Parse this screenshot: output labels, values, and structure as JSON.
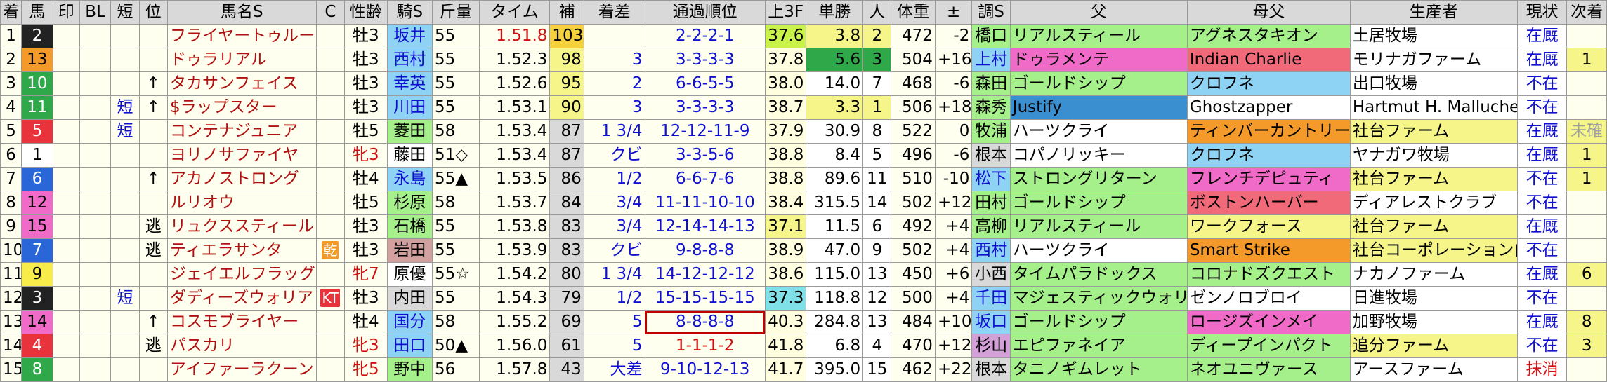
{
  "headers": [
    "着",
    "馬",
    "印",
    "BL",
    "短",
    "位",
    "馬名S",
    "C",
    "性齢",
    "騎S",
    "斤量",
    "タイム",
    "補",
    "着差",
    "通過順位",
    "上3F",
    "単勝",
    "人",
    "体重",
    "±",
    "調S",
    "父",
    "母父",
    "生産者",
    "現状",
    "次着"
  ],
  "colors": {
    "frame": [
      "#ffffff",
      "#ffffff",
      "#222222",
      "#e8323c",
      "#2a66d8",
      "#f8ec4a",
      "#2fa84a",
      "#f39a2a",
      "#f06ac8"
    ],
    "frame_text": [
      "#000000",
      "#000000",
      "#ffffff",
      "#ffffff",
      "#ffffff",
      "#000000",
      "#ffffff",
      "#000000",
      "#000000"
    ],
    "row_bg": "#fffff0",
    "gray_col": "#d9d9d9"
  },
  "rows": [
    {
      "rank": "1",
      "frame": 2,
      "num": "2",
      "mark": "",
      "bl": "",
      "short": "",
      "pos": "",
      "name": "フライヤートゥルー",
      "c": "",
      "c_bg": "",
      "sex": "牡3",
      "sex_red": false,
      "jockey": "坂井",
      "jockey_bg": "#8fd3f4",
      "jockey_blue": true,
      "weight": "55",
      "weight_mark": "",
      "time": "1.51.8",
      "time_red": true,
      "hosei": "103",
      "hosei_bg": "#f5d23d",
      "chakusa": "",
      "pass": [
        "2",
        "2",
        "2",
        "1"
      ],
      "pass_box": false,
      "pass_red": false,
      "f3": "37.6",
      "f3_bg": "#c9f24a",
      "odds": "3.8",
      "odds_bg": "#f5f58a",
      "ninki": "2",
      "ninki_bg": "#f5f58a",
      "bw": "472",
      "diff": "-2",
      "trainer": "橋口",
      "trainer_bg": "#a5f08a",
      "trainer_blue": false,
      "sire": "リアルスティール",
      "sire_bg": "#a5f08a",
      "ds": "アグネスタキオン",
      "ds_bg": "#a5f08a",
      "breeder": "土居牧場",
      "breeder_bg": "#ffffff",
      "status": "在厩",
      "status_color": "blue",
      "next": ""
    },
    {
      "rank": "2",
      "frame": 7,
      "num": "13",
      "mark": "",
      "bl": "",
      "short": "",
      "pos": "",
      "name": "ドゥラリアル",
      "c": "",
      "c_bg": "",
      "sex": "牡3",
      "sex_red": false,
      "jockey": "西村",
      "jockey_bg": "#8fd3f4",
      "jockey_blue": true,
      "weight": "55",
      "weight_mark": "",
      "time": "1.52.3",
      "time_red": false,
      "hosei": "98",
      "hosei_bg": "#f5f58a",
      "chakusa": "3",
      "pass": [
        "3",
        "3",
        "3",
        "3"
      ],
      "pass_box": false,
      "pass_red": false,
      "f3": "37.8",
      "f3_bg": "#ffffe0",
      "odds": "5.6",
      "odds_bg": "#2fa84a",
      "ninki": "3",
      "ninki_bg": "#2fa84a",
      "bw": "504",
      "diff": "+16",
      "trainer": "上村",
      "trainer_bg": "#8fd3f4",
      "trainer_blue": true,
      "sire": "ドゥラメンテ",
      "sire_bg": "#f06ac8",
      "ds": "Indian Charlie",
      "ds_bg": "#f06a7a",
      "breeder": "モリナガファーム",
      "breeder_bg": "#ffffff",
      "status": "在厩",
      "status_color": "blue",
      "next": "1"
    },
    {
      "rank": "3",
      "frame": 6,
      "num": "10",
      "mark": "",
      "bl": "",
      "short": "",
      "pos": "↑",
      "name": "タカサンフェイス",
      "c": "",
      "c_bg": "",
      "sex": "牡3",
      "sex_red": false,
      "jockey": "幸英",
      "jockey_bg": "#8fd3f4",
      "jockey_blue": true,
      "weight": "55",
      "weight_mark": "",
      "time": "1.52.6",
      "time_red": false,
      "hosei": "95",
      "hosei_bg": "#f5f58a",
      "chakusa": "2",
      "pass": [
        "6",
        "6",
        "5",
        "5"
      ],
      "pass_box": false,
      "pass_red": false,
      "f3": "38.0",
      "f3_bg": "#ffffe0",
      "odds": "14.0",
      "odds_bg": "#ffffff",
      "ninki": "7",
      "ninki_bg": "#ffffff",
      "bw": "468",
      "diff": "-6",
      "trainer": "森田",
      "trainer_bg": "#a5f08a",
      "trainer_blue": false,
      "sire": "ゴールドシップ",
      "sire_bg": "#a5f08a",
      "ds": "クロフネ",
      "ds_bg": "#8fd3f4",
      "breeder": "出口牧場",
      "breeder_bg": "#ffffff",
      "status": "不在",
      "status_color": "blue",
      "next": ""
    },
    {
      "rank": "4",
      "frame": 6,
      "num": "11",
      "mark": "",
      "bl": "",
      "short": "短",
      "pos": "↑",
      "name": "$ラップスター",
      "c": "",
      "c_bg": "",
      "sex": "牡3",
      "sex_red": false,
      "jockey": "川田",
      "jockey_bg": "#8fd3f4",
      "jockey_blue": true,
      "weight": "55",
      "weight_mark": "",
      "time": "1.53.1",
      "time_red": false,
      "hosei": "90",
      "hosei_bg": "#f5f58a",
      "chakusa": "3",
      "pass": [
        "3",
        "3",
        "3",
        "3"
      ],
      "pass_box": false,
      "pass_red": false,
      "f3": "38.7",
      "f3_bg": "#ffffe0",
      "odds": "3.3",
      "odds_bg": "#f5f58a",
      "ninki": "1",
      "ninki_bg": "#f5f58a",
      "bw": "506",
      "diff": "+18",
      "trainer": "森秀",
      "trainer_bg": "#a5f08a",
      "trainer_blue": false,
      "sire": "Justify",
      "sire_bg": "#3a8fd0",
      "ds": "Ghostzapper",
      "ds_bg": "#ffffff",
      "breeder": "Hartmut H. Malluche",
      "breeder_bg": "#ffffff",
      "status": "不在",
      "status_color": "blue",
      "next": ""
    },
    {
      "rank": "5",
      "frame": 3,
      "num": "5",
      "mark": "",
      "bl": "",
      "short": "短",
      "pos": "",
      "name": "コンテナジュニア",
      "c": "",
      "c_bg": "",
      "sex": "牡5",
      "sex_red": false,
      "jockey": "菱田",
      "jockey_bg": "#a5f08a",
      "jockey_blue": false,
      "weight": "58",
      "weight_mark": "",
      "time": "1.53.4",
      "time_red": false,
      "hosei": "87",
      "hosei_bg": "",
      "chakusa": "1 3/4",
      "pass": [
        "12",
        "12",
        "11",
        "9"
      ],
      "pass_box": false,
      "pass_red": false,
      "f3": "37.9",
      "f3_bg": "#ffffe0",
      "odds": "30.9",
      "odds_bg": "#ffffff",
      "ninki": "8",
      "ninki_bg": "#ffffff",
      "bw": "522",
      "diff": "0",
      "trainer": "牧浦",
      "trainer_bg": "#a5f08a",
      "trainer_blue": false,
      "sire": "ハーツクライ",
      "sire_bg": "#ffffff",
      "ds": "ティンバーカントリー",
      "ds_bg": "#f39a2a",
      "breeder": "社台ファーム",
      "breeder_bg": "#f5f58a",
      "status": "在厩",
      "status_color": "blue",
      "next": "未確",
      "next_gray": true
    },
    {
      "rank": "6",
      "frame": 1,
      "num": "1",
      "mark": "",
      "bl": "",
      "short": "",
      "pos": "",
      "name": "ヨリノサファイヤ",
      "c": "",
      "c_bg": "",
      "sex": "牝3",
      "sex_red": true,
      "jockey": "藤田",
      "jockey_bg": "#ffffff",
      "jockey_blue": false,
      "weight": "51",
      "weight_mark": "◇",
      "time": "1.53.4",
      "time_red": false,
      "hosei": "87",
      "hosei_bg": "",
      "chakusa": "クビ",
      "pass": [
        "3",
        "3",
        "5",
        "6"
      ],
      "pass_box": false,
      "pass_red": false,
      "f3": "38.8",
      "f3_bg": "#ffffe0",
      "odds": "8.4",
      "odds_bg": "#ffffff",
      "ninki": "5",
      "ninki_bg": "#ffffff",
      "bw": "496",
      "diff": "-6",
      "trainer": "根本",
      "trainer_bg": "#d9d9d9",
      "trainer_blue": false,
      "sire": "コパノリッキー",
      "sire_bg": "#ffffff",
      "ds": "クロフネ",
      "ds_bg": "#8fd3f4",
      "breeder": "ヤナガワ牧場",
      "breeder_bg": "#ffffff",
      "status": "在厩",
      "status_color": "blue",
      "next": "1"
    },
    {
      "rank": "7",
      "frame": 4,
      "num": "6",
      "mark": "",
      "bl": "",
      "short": "",
      "pos": "↑",
      "name": "アカノストロング",
      "c": "",
      "c_bg": "",
      "sex": "牡4",
      "sex_red": false,
      "jockey": "永島",
      "jockey_bg": "#8fd3f4",
      "jockey_blue": true,
      "weight": "55",
      "weight_mark": "▲",
      "time": "1.53.5",
      "time_red": false,
      "hosei": "86",
      "hosei_bg": "",
      "chakusa": "1/2",
      "pass": [
        "6",
        "6",
        "7",
        "6"
      ],
      "pass_box": false,
      "pass_red": false,
      "f3": "38.8",
      "f3_bg": "#ffffe0",
      "odds": "89.6",
      "odds_bg": "#ffffff",
      "ninki": "11",
      "ninki_bg": "#ffffff",
      "bw": "510",
      "diff": "-10",
      "trainer": "松下",
      "trainer_bg": "#8fd3f4",
      "trainer_blue": true,
      "sire": "ストロングリターン",
      "sire_bg": "#a5f08a",
      "ds": "フレンチデピュティ",
      "ds_bg": "#f06ac8",
      "breeder": "社台ファーム",
      "breeder_bg": "#f5f58a",
      "status": "不在",
      "status_color": "blue",
      "next": "1"
    },
    {
      "rank": "8",
      "frame": 8,
      "num": "12",
      "mark": "",
      "bl": "",
      "short": "",
      "pos": "",
      "name": "ルリオウ",
      "c": "",
      "c_bg": "",
      "sex": "牡5",
      "sex_red": false,
      "jockey": "杉原",
      "jockey_bg": "#a5f08a",
      "jockey_blue": false,
      "weight": "58",
      "weight_mark": "",
      "time": "1.53.7",
      "time_red": false,
      "hosei": "84",
      "hosei_bg": "",
      "chakusa": "3/4",
      "pass": [
        "11",
        "11",
        "10",
        "10"
      ],
      "pass_box": false,
      "pass_red": false,
      "f3": "38.4",
      "f3_bg": "#ffffe0",
      "odds": "315.5",
      "odds_bg": "#ffffff",
      "ninki": "14",
      "ninki_bg": "#ffffff",
      "bw": "502",
      "diff": "+12",
      "trainer": "田村",
      "trainer_bg": "#a5f08a",
      "trainer_blue": false,
      "sire": "ゴールドシップ",
      "sire_bg": "#a5f08a",
      "ds": "ボストンハーバー",
      "ds_bg": "#f06a7a",
      "breeder": "ディアレストクラブ",
      "breeder_bg": "#ffffff",
      "status": "不在",
      "status_color": "blue",
      "next": ""
    },
    {
      "rank": "9",
      "frame": 8,
      "num": "15",
      "mark": "",
      "bl": "",
      "short": "",
      "pos": "逃",
      "name": "リュクススティール",
      "c": "",
      "c_bg": "",
      "sex": "牡3",
      "sex_red": false,
      "jockey": "石橋",
      "jockey_bg": "#a5f08a",
      "jockey_blue": false,
      "weight": "55",
      "weight_mark": "",
      "time": "1.53.8",
      "time_red": false,
      "hosei": "83",
      "hosei_bg": "",
      "chakusa": "3/4",
      "pass": [
        "12",
        "14",
        "14",
        "13"
      ],
      "pass_box": false,
      "pass_red": false,
      "f3": "37.1",
      "f3_bg": "#f5f58a",
      "odds": "11.5",
      "odds_bg": "#ffffff",
      "ninki": "6",
      "ninki_bg": "#ffffff",
      "bw": "492",
      "diff": "+4",
      "trainer": "高柳",
      "trainer_bg": "#a5f08a",
      "trainer_blue": false,
      "sire": "リアルスティール",
      "sire_bg": "#a5f08a",
      "ds": "ワークフォース",
      "ds_bg": "#f5f58a",
      "breeder": "社台ファーム",
      "breeder_bg": "#f5f58a",
      "status": "在厩",
      "status_color": "blue",
      "next": ""
    },
    {
      "rank": "10",
      "frame": 4,
      "num": "7",
      "mark": "",
      "bl": "",
      "short": "",
      "pos": "逃",
      "name": "ティエラサンタ",
      "c": "乾",
      "c_bg": "#f39a2a",
      "sex": "牡3",
      "sex_red": false,
      "jockey": "岩田",
      "jockey_bg": "#d3a0a0",
      "jockey_blue": false,
      "weight": "55",
      "weight_mark": "",
      "time": "1.53.9",
      "time_red": false,
      "hosei": "83",
      "hosei_bg": "",
      "chakusa": "クビ",
      "pass": [
        "9",
        "8",
        "8",
        "8"
      ],
      "pass_box": false,
      "pass_red": false,
      "f3": "38.9",
      "f3_bg": "#ffffe0",
      "odds": "47.0",
      "odds_bg": "#ffffff",
      "ninki": "9",
      "ninki_bg": "#ffffff",
      "bw": "502",
      "diff": "+4",
      "trainer": "西村",
      "trainer_bg": "#8fd3f4",
      "trainer_blue": true,
      "sire": "ハーツクライ",
      "sire_bg": "#ffffff",
      "ds": "Smart Strike",
      "ds_bg": "#f39a2a",
      "breeder": "社台コーポレーション白",
      "breeder_bg": "#f5f58a",
      "status": "不在",
      "status_color": "blue",
      "next": ""
    },
    {
      "rank": "11",
      "frame": 5,
      "num": "9",
      "mark": "",
      "bl": "",
      "short": "",
      "pos": "",
      "name": "ジェイエルフラッグ",
      "c": "",
      "c_bg": "",
      "sex": "牝7",
      "sex_red": true,
      "jockey": "原優",
      "jockey_bg": "#ffffff",
      "jockey_blue": false,
      "weight": "55",
      "weight_mark": "☆",
      "time": "1.54.2",
      "time_red": false,
      "hosei": "80",
      "hosei_bg": "",
      "chakusa": "1 3/4",
      "pass": [
        "14",
        "12",
        "12",
        "12"
      ],
      "pass_box": false,
      "pass_red": false,
      "f3": "38.6",
      "f3_bg": "#ffffe0",
      "odds": "115.0",
      "odds_bg": "#ffffff",
      "ninki": "13",
      "ninki_bg": "#ffffff",
      "bw": "450",
      "diff": "+6",
      "trainer": "小西",
      "trainer_bg": "#d9d9d9",
      "trainer_blue": false,
      "sire": "タイムパラドックス",
      "sire_bg": "#a5f08a",
      "ds": "コロナドズクエスト",
      "ds_bg": "#a5f08a",
      "breeder": "ナカノファーム",
      "breeder_bg": "#ffffff",
      "status": "在厩",
      "status_color": "blue",
      "next": "6"
    },
    {
      "rank": "12",
      "frame": 2,
      "num": "3",
      "mark": "",
      "bl": "",
      "short": "短",
      "pos": "",
      "name": "ダディーズウォリア",
      "c": "KT",
      "c_bg": "#e8323c",
      "sex": "牡3",
      "sex_red": false,
      "jockey": "内田",
      "jockey_bg": "#d9d9d9",
      "jockey_blue": false,
      "weight": "55",
      "weight_mark": "",
      "time": "1.54.3",
      "time_red": false,
      "hosei": "79",
      "hosei_bg": "",
      "chakusa": "1/2",
      "pass": [
        "15",
        "15",
        "15",
        "15"
      ],
      "pass_box": false,
      "pass_red": false,
      "f3": "37.3",
      "f3_bg": "#7fe0e8",
      "odds": "118.8",
      "odds_bg": "#ffffff",
      "ninki": "12",
      "ninki_bg": "#ffffff",
      "bw": "500",
      "diff": "+4",
      "trainer": "千田",
      "trainer_bg": "#8fd3f4",
      "trainer_blue": true,
      "sire": "マジェスティックウォリアー",
      "sire_bg": "#a5f08a",
      "ds": "ゼンノロブロイ",
      "ds_bg": "#ffffff",
      "breeder": "日進牧場",
      "breeder_bg": "#ffffff",
      "status": "不在",
      "status_color": "blue",
      "next": ""
    },
    {
      "rank": "13",
      "frame": 8,
      "num": "14",
      "mark": "",
      "bl": "",
      "short": "",
      "pos": "↑",
      "name": "コスモブライヤー",
      "c": "",
      "c_bg": "",
      "sex": "牡4",
      "sex_red": false,
      "jockey": "国分",
      "jockey_bg": "#8fd3f4",
      "jockey_blue": true,
      "weight": "58",
      "weight_mark": "",
      "time": "1.55.2",
      "time_red": false,
      "hosei": "69",
      "hosei_bg": "",
      "chakusa": "5",
      "pass": [
        "8",
        "8",
        "8",
        "8"
      ],
      "pass_box": true,
      "pass_red": false,
      "f3": "40.3",
      "f3_bg": "#ffffe0",
      "odds": "284.8",
      "odds_bg": "#ffffff",
      "ninki": "13",
      "ninki_bg": "#ffffff",
      "bw": "484",
      "diff": "+10",
      "trainer": "坂口",
      "trainer_bg": "#8fd3f4",
      "trainer_blue": true,
      "sire": "ゴールドシップ",
      "sire_bg": "#a5f08a",
      "ds": "ロージズインメイ",
      "ds_bg": "#f06ac8",
      "breeder": "加野牧場",
      "breeder_bg": "#ffffff",
      "status": "在厩",
      "status_color": "blue",
      "next": "8"
    },
    {
      "rank": "14",
      "frame": 3,
      "num": "4",
      "mark": "",
      "bl": "",
      "short": "",
      "pos": "逃",
      "name": "パスカリ",
      "c": "",
      "c_bg": "",
      "sex": "牝3",
      "sex_red": true,
      "jockey": "田口",
      "jockey_bg": "#8fd3f4",
      "jockey_blue": true,
      "weight": "50",
      "weight_mark": "▲",
      "time": "1.56.0",
      "time_red": false,
      "hosei": "61",
      "hosei_bg": "",
      "chakusa": "5",
      "pass": [
        "1",
        "1",
        "1",
        "2"
      ],
      "pass_box": false,
      "pass_red": true,
      "f3": "41.8",
      "f3_bg": "#ffffe0",
      "odds": "6.8",
      "odds_bg": "#ffffff",
      "ninki": "4",
      "ninki_bg": "#ffffff",
      "bw": "470",
      "diff": "+12",
      "trainer": "杉山",
      "trainer_bg": "#d3a0d8",
      "trainer_blue": false,
      "sire": "エピファネイア",
      "sire_bg": "#a5f08a",
      "ds": "ディープインパクト",
      "ds_bg": "#a5f08a",
      "breeder": "追分ファーム",
      "breeder_bg": "#f5f58a",
      "status": "不在",
      "status_color": "blue",
      "next": "3"
    },
    {
      "rank": "15",
      "frame": 6,
      "num": "8",
      "mark": "",
      "bl": "",
      "short": "",
      "pos": "",
      "name": "アイファーラクーン",
      "c": "",
      "c_bg": "",
      "sex": "牝5",
      "sex_red": true,
      "jockey": "野中",
      "jockey_bg": "#a5f08a",
      "jockey_blue": false,
      "weight": "56",
      "weight_mark": "",
      "time": "1.57.8",
      "time_red": false,
      "hosei": "43",
      "hosei_bg": "",
      "chakusa": "大差",
      "pass": [
        "9",
        "10",
        "12",
        "13"
      ],
      "pass_box": false,
      "pass_red": false,
      "f3": "41.7",
      "f3_bg": "#ffffe0",
      "odds": "395.0",
      "odds_bg": "#ffffff",
      "ninki": "15",
      "ninki_bg": "#ffffff",
      "bw": "462",
      "diff": "+22",
      "trainer": "根本",
      "trainer_bg": "#d9d9d9",
      "trainer_blue": false,
      "sire": "タニノギムレット",
      "sire_bg": "#a5f08a",
      "ds": "ネオユニヴァース",
      "ds_bg": "#a5f08a",
      "breeder": "アースファーム",
      "breeder_bg": "#ffffff",
      "status": "抹消",
      "status_color": "red",
      "next": ""
    }
  ]
}
